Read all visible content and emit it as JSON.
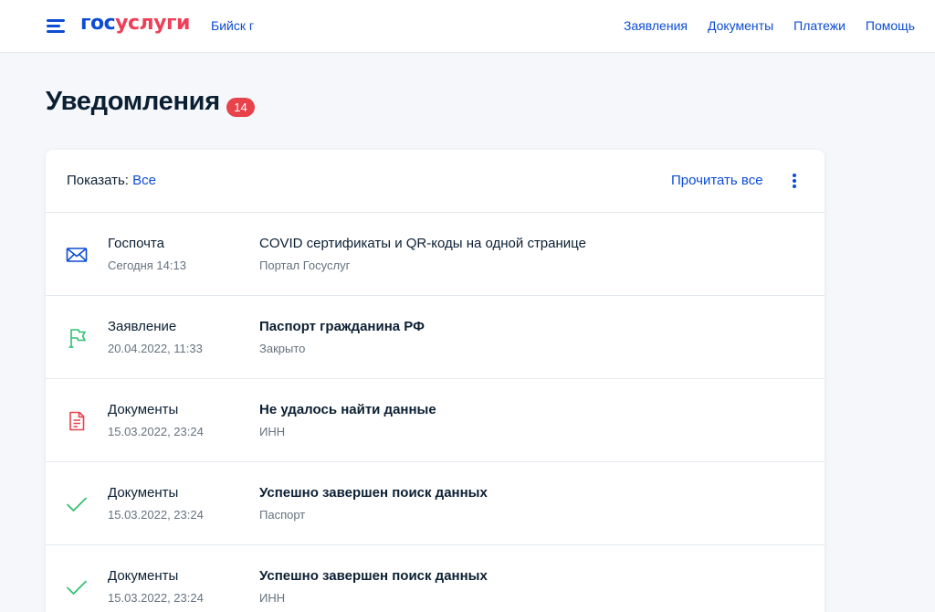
{
  "header": {
    "logo": {
      "part1": "гос",
      "part2": "услуги"
    },
    "city": "Бийск г",
    "nav": [
      "Заявления",
      "Документы",
      "Платежи",
      "Помощь"
    ],
    "icons": {
      "menu": "burger-menu-icon"
    }
  },
  "page": {
    "title": "Уведомления",
    "count": "14"
  },
  "toolbar": {
    "show_label": "Показать:",
    "show_value": "Все",
    "read_all": "Прочитать все",
    "more_icon": "vertical-dots-icon"
  },
  "notifications": [
    {
      "icon": "mail-icon",
      "category": "Госпочта",
      "date": "Сегодня 14:13",
      "title": "COVID сертификаты и QR-коды на одной странице",
      "subtitle": "Портал Госуслуг",
      "bold": false
    },
    {
      "icon": "flag-icon",
      "category": "Заявление",
      "date": "20.04.2022, 11:33",
      "title": "Паспорт гражданина РФ",
      "subtitle": "Закрыто",
      "bold": true
    },
    {
      "icon": "document-icon",
      "category": "Документы",
      "date": "15.03.2022, 23:24",
      "title": "Не удалось найти данные",
      "subtitle": "ИНН",
      "bold": true
    },
    {
      "icon": "check-icon",
      "category": "Документы",
      "date": "15.03.2022, 23:24",
      "title": "Успешно завершен поиск данных",
      "subtitle": "Паспорт",
      "bold": true
    },
    {
      "icon": "check-icon",
      "category": "Документы",
      "date": "15.03.2022, 23:24",
      "title": "Успешно завершен поиск данных",
      "subtitle": "ИНН",
      "bold": true
    }
  ],
  "colors": {
    "brand_blue": "#0d4cd3",
    "brand_red": "#ee3f58",
    "badge": "#e8424b",
    "success": "#2fbf71",
    "error": "#e8424b",
    "text": "#0b1f33",
    "muted": "#66727f",
    "background": "#f5f7fb"
  }
}
